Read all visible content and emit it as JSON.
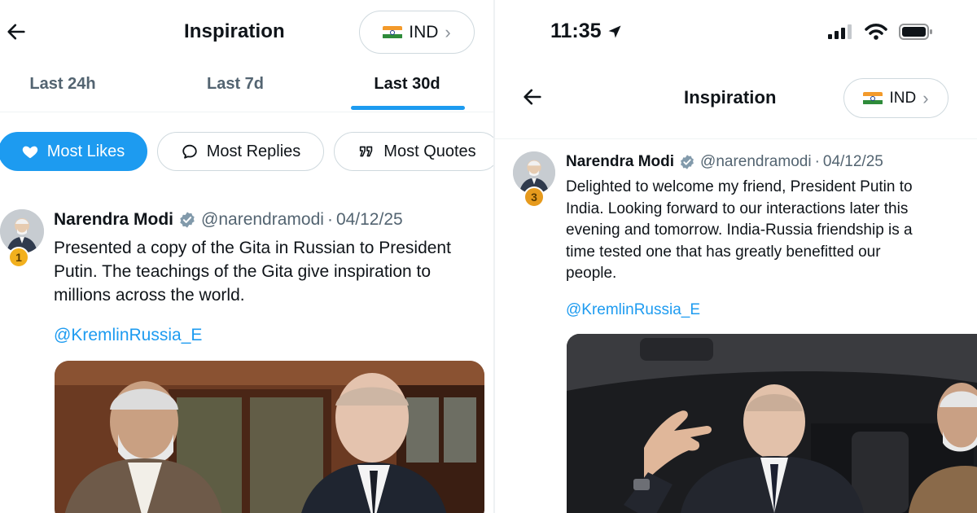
{
  "left": {
    "header": {
      "title": "Inspiration",
      "country": "IND"
    },
    "tabs": [
      {
        "label": "Last 24h"
      },
      {
        "label": "Last 7d"
      },
      {
        "label": "Last 30d",
        "active": true
      }
    ],
    "filters": [
      {
        "label": "Most Likes",
        "icon": "heart-icon",
        "active": true
      },
      {
        "label": "Most Replies",
        "icon": "reply-bubble-icon"
      },
      {
        "label": "Most Quotes",
        "icon": "quote-icon"
      }
    ],
    "tweet": {
      "rank": "1",
      "name": "Narendra Modi",
      "handle": "@narendramodi",
      "separator": "·",
      "date": "04/12/25",
      "text_lines": [
        "Presented a copy of the Gita in Russian to President",
        "Putin. The teachings of the Gita give inspiration to",
        "millions across the world."
      ],
      "mention": "@KremlinRussia_E"
    }
  },
  "right": {
    "status_bar": {
      "time": "11:35"
    },
    "header": {
      "title": "Inspiration",
      "country": "IND"
    },
    "tweet": {
      "rank": "3",
      "name": "Narendra Modi",
      "handle": "@narendramodi",
      "separator": "·",
      "date": "04/12/25",
      "text_lines": [
        "Delighted to welcome my friend, President Putin to",
        "India. Looking forward to our interactions later this",
        "evening and tomorrow. India-Russia friendship is a",
        "time tested one that has greatly benefitted our",
        "people."
      ],
      "mention": "@KremlinRussia_E"
    }
  },
  "colors": {
    "accent": "#1d9bf0",
    "muted_text": "#536471",
    "rank_badge": "#f2b01e",
    "border": "#cfd9de"
  }
}
